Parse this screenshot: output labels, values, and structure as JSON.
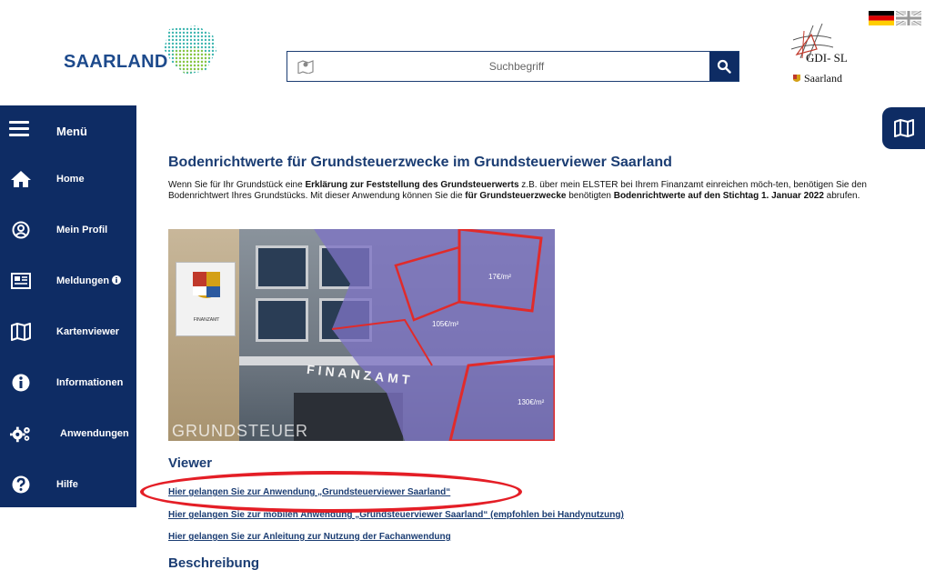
{
  "header": {
    "logo_text": "SAARLAND",
    "search_placeholder": "Suchbegriff",
    "gdi_text": "GDI- SL",
    "gdi_sub": "Saarland"
  },
  "sidebar": {
    "menu_label": "Menü",
    "items": [
      {
        "label": "Home",
        "icon": "home-icon"
      },
      {
        "label": "Mein Profil",
        "icon": "user-circle-icon"
      },
      {
        "label": "Meldungen",
        "icon": "newspaper-icon"
      },
      {
        "label": "Kartenviewer",
        "icon": "map-icon"
      },
      {
        "label": "Informationen",
        "icon": "info-icon"
      },
      {
        "label": "Anwendungen",
        "icon": "gears-icon"
      },
      {
        "label": "Hilfe",
        "icon": "question-icon"
      }
    ]
  },
  "content": {
    "title": "Bodenrichtwerte für Grundsteuerzwecke im Grundsteuerviewer Saarland",
    "intro": {
      "p1": "Wenn Sie für Ihr Grundstück eine ",
      "b1": "Erklärung zur Feststellung des Grundsteuerwerts",
      "p2": " z.B. über mein ELSTER bei Ihrem Finanzamt einreichen möch-ten, benötigen Sie den Bodenrichtwert Ihres Grundstücks. Mit dieser Anwendung können Sie die ",
      "b2": "für Grundsteuerzwecke",
      "p3": " benötigten ",
      "b3": "Bodenrichtwerte auf den Stichtag 1. Januar 2022",
      "p4": " abrufen."
    },
    "hero": {
      "sign_label": "FINANZAMT",
      "facade_text": "FINANZAMT",
      "caption": "GRUNDSTEUER",
      "price1": "17€/m²",
      "price2": "105€/m²",
      "price3": "130€/m²"
    },
    "viewer_title": "Viewer",
    "links": [
      "Hier gelangen Sie zur Anwendung „Grundsteuerviewer Saarland“",
      "Hier gelangen Sie zur mobilen Anwendung „Grundsteuerviewer Saarland“ (empfohlen bei Handynutzung)",
      "Hier gelangen Sie zur Anleitung zur Nutzung der Fachanwendung"
    ],
    "description_title": "Beschreibung"
  },
  "colors": {
    "navy": "#0e2c64",
    "link_blue": "#1b3d73",
    "highlight_red": "#e41e26"
  }
}
